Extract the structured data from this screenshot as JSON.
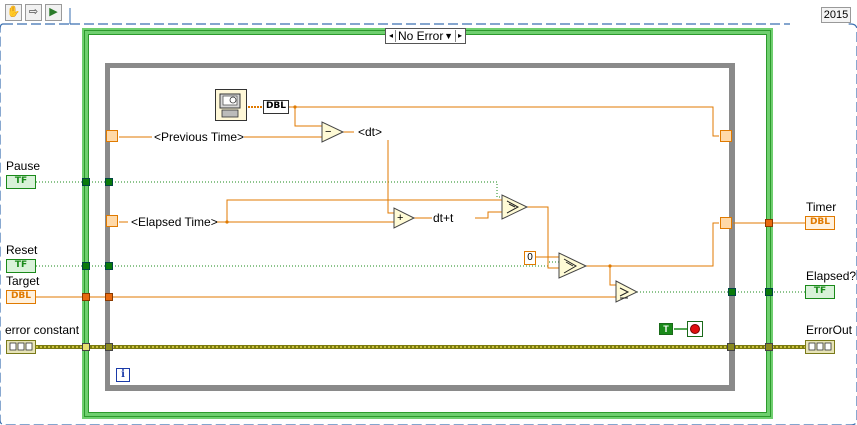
{
  "toolbar": {
    "items": [
      {
        "name": "hand-tool-icon",
        "glyph": "✋"
      },
      {
        "name": "arrow-tool-icon",
        "glyph": "⇨"
      },
      {
        "name": "run-arrow-icon",
        "glyph": "▶"
      }
    ],
    "version": "2015"
  },
  "case_structure": {
    "selector_value": "No Error",
    "selector_arrow": "▼",
    "prev_glyph": "◂",
    "next_glyph": "▸"
  },
  "inputs": {
    "pause": {
      "label": "Pause",
      "type_text": "TF"
    },
    "reset": {
      "label": "Reset",
      "type_text": "TF"
    },
    "target": {
      "label": "Target",
      "type_text": "DBL"
    },
    "error_constant": {
      "label": "error constant"
    }
  },
  "outputs": {
    "timer": {
      "label": "Timer",
      "type_text": "DBL"
    },
    "elapsed": {
      "label": "Elapsed?",
      "type_text": "TF"
    },
    "error_out": {
      "label": "ErrorOut"
    }
  },
  "nodes": {
    "timer_function_type": "DBL",
    "previous_time": "<Previous Time>",
    "elapsed_time": "<Elapsed Time>",
    "dt": "<dt>",
    "dt_plus_t": "dt+t",
    "subtract_symbol": "−",
    "add_symbol": "+",
    "zero_constant": "0",
    "true_constant": "T",
    "iteration_symbol": "i"
  },
  "colors": {
    "bool_wire": "#1a8a1a",
    "double_wire": "#e07a00",
    "error_wire": "#8a8a1a",
    "case_border": "#6fcf6f",
    "loop_border": "#8a8a8a"
  }
}
